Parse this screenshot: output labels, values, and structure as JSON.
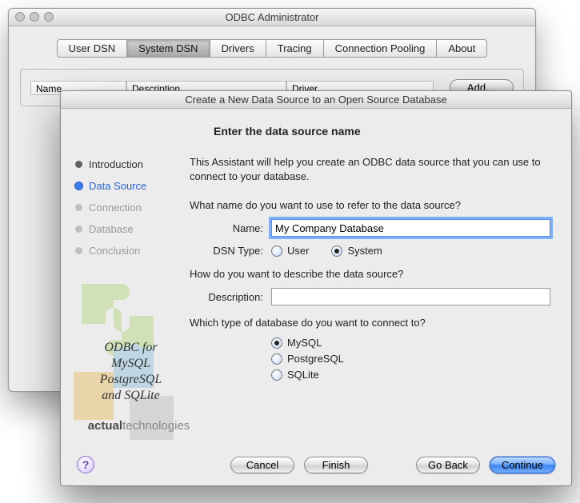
{
  "back_window": {
    "title": "ODBC Administrator",
    "tabs": [
      "User DSN",
      "System DSN",
      "Drivers",
      "Tracing",
      "Connection Pooling",
      "About"
    ],
    "active_tab_index": 1,
    "columns": [
      "Name",
      "Description",
      "Driver"
    ],
    "add_button": "Add…"
  },
  "sheet": {
    "title": "Create a New Data Source to an Open Source Database",
    "steps": [
      {
        "label": "Introduction",
        "state": "done"
      },
      {
        "label": "Data Source",
        "state": "active"
      },
      {
        "label": "Connection",
        "state": "pending"
      },
      {
        "label": "Database",
        "state": "pending"
      },
      {
        "label": "Conclusion",
        "state": "pending"
      }
    ],
    "brand_lines": [
      "ODBC for",
      "MySQL",
      "PostgreSQL",
      "and SQLite"
    ],
    "brand_logo_bold": "actual",
    "brand_logo_rest": "technologies",
    "heading": "Enter the data source name",
    "intro": "This Assistant will help you create an ODBC data source that you can use to connect to your database.",
    "q_name": "What name do you want to use to refer to the data source?",
    "name_label": "Name:",
    "name_value": "My Company Database",
    "dsn_type_label": "DSN Type:",
    "dsn_user": "User",
    "dsn_system": "System",
    "dsn_selected": "System",
    "q_desc": "How do you want to describe the data source?",
    "desc_label": "Description:",
    "desc_value": "",
    "q_db": "Which type of database do you want to connect to?",
    "db_options": [
      "MySQL",
      "PostgreSQL",
      "SQLite"
    ],
    "db_selected": "MySQL",
    "buttons": {
      "cancel": "Cancel",
      "finish": "Finish",
      "back": "Go Back",
      "continue": "Continue"
    }
  }
}
